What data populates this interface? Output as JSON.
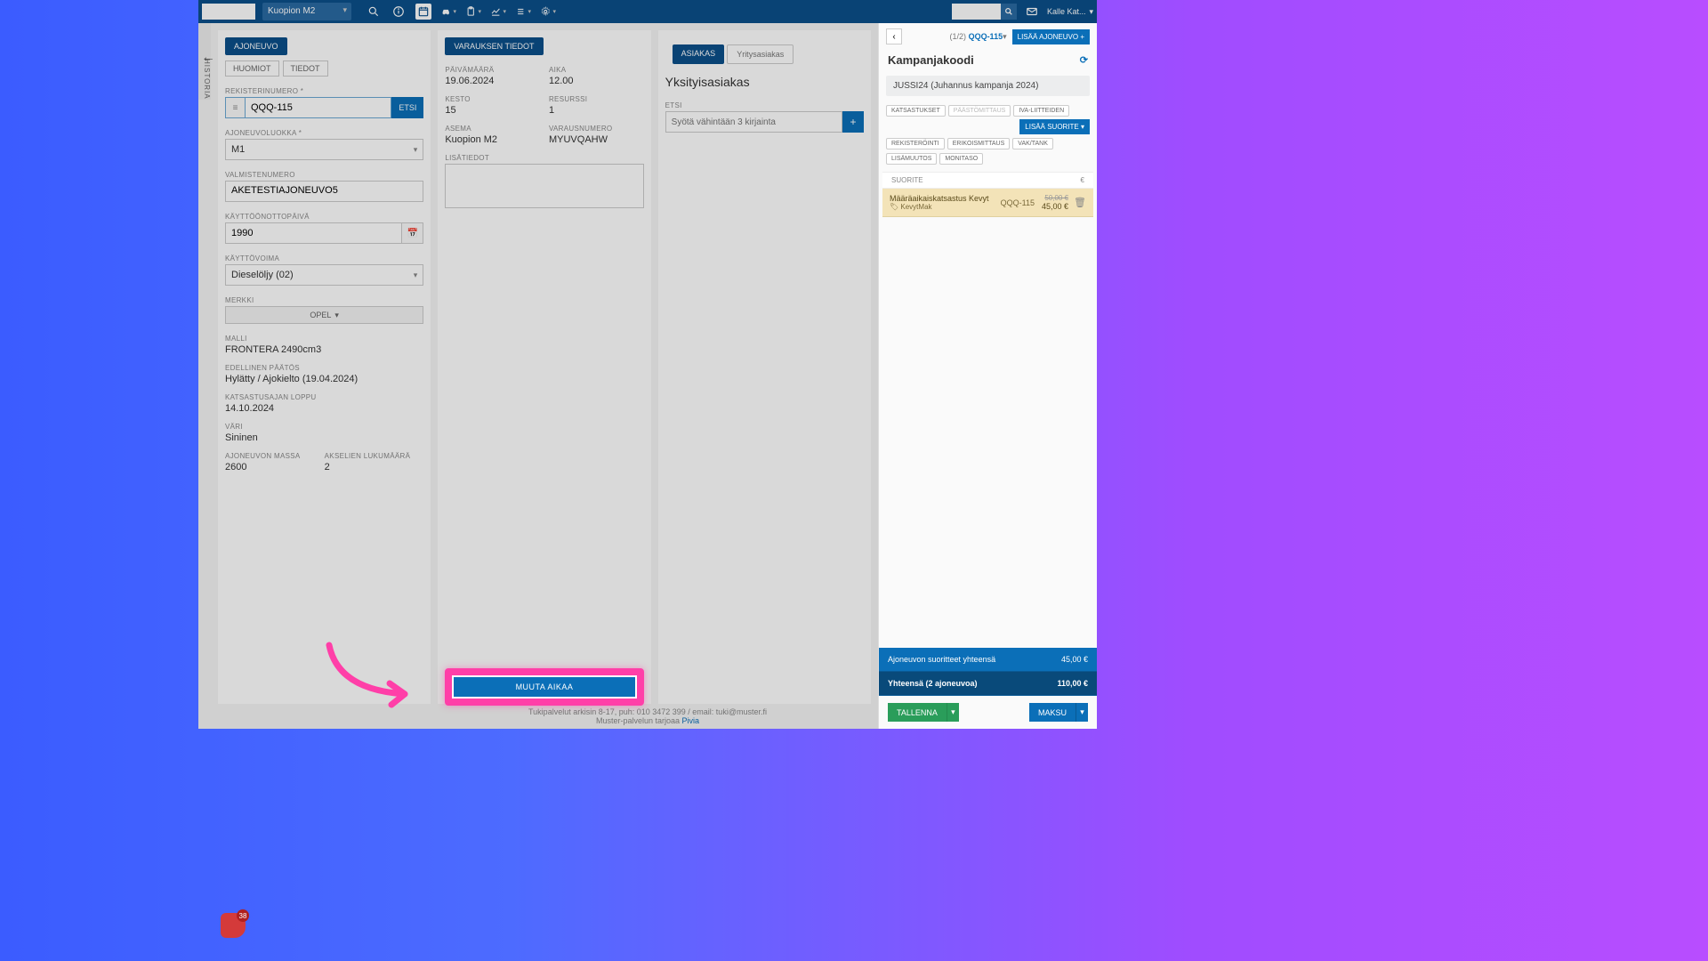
{
  "header": {
    "location": "Kuopion M2",
    "user": "Kalle Kat..."
  },
  "history_tab": "HISTORIA",
  "col1": {
    "tab": "AJONEUVO",
    "subtabs": {
      "huomiot": "HUOMIOT",
      "tiedot": "TIEDOT"
    },
    "labels": {
      "rek": "REKISTERINUMERO *",
      "luokka": "AJONEUVOLUOKKA *",
      "valm": "VALMISTENUMERO",
      "kayttopv": "KÄYTTÖÖNOTTOPÄIVÄ",
      "voima": "KÄYTTÖVOIMA",
      "merkki": "MERKKI",
      "malli": "MALLI",
      "paatos": "EDELLINEN PÄÄTÖS",
      "katsloppu": "KATSASTUSAJAN LOPPU",
      "vari": "VÄRI",
      "massa": "AJONEUVON MASSA",
      "akselit": "AKSELIEN LUKUMÄÄRÄ"
    },
    "values": {
      "rek": "QQQ-115",
      "etsi": "ETSI",
      "luokka": "M1",
      "valm": "AKETESTIAJONEUVO5",
      "kayttopv": "1990",
      "voima": "Dieselöljy (02)",
      "merkki": "OPEL",
      "malli": "FRONTERA 2490cm3",
      "paatos": "Hylätty / Ajokielto (19.04.2024)",
      "katsloppu": "14.10.2024",
      "vari": "Sininen",
      "massa": "2600",
      "akselit": "2"
    }
  },
  "col2": {
    "tab": "VARAUKSEN TIEDOT",
    "labels": {
      "pvm": "PÄIVÄMÄÄRÄ",
      "aika": "AIKA",
      "kesto": "KESTO",
      "resurssi": "RESURSSI",
      "asema": "ASEMA",
      "varausnro": "VARAUSNUMERO",
      "lisat": "LISÄTIEDOT"
    },
    "values": {
      "pvm": "19.06.2024",
      "aika": "12.00",
      "kesto": "15",
      "resurssi": "1",
      "asema": "Kuopion M2",
      "varausnro": "MYUVQAHW"
    },
    "muuta": "MUUTA AIKAA"
  },
  "col3": {
    "tabs": {
      "asiakas": "ASIAKAS",
      "yritys": "Yritysasiakas"
    },
    "cust_type": "Yksityisasiakas",
    "etsi_label": "ETSI",
    "etsi_placeholder": "Syötä vähintään 3 kirjainta"
  },
  "right": {
    "counter_a": "(1/2)",
    "counter_b": "QQQ-115",
    "add_vehicle": "LISÄÄ AJONEUVO +",
    "title": "Kampanjakoodi",
    "campaign": "JUSSI24 (Juhannus kampanja 2024)",
    "chips": [
      "KATSASTUKSET",
      "PÄÄSTÖMITTAUS",
      "IVA-LIITTEIDEN",
      "REKISTERÖINTI",
      "ERIKOISMITTAUS",
      "LISÄMUUTOS",
      "VAK/TANK",
      "MONITASO"
    ],
    "add_suorite": "LISÄÄ SUORITE ▾",
    "hdr": {
      "suorite": "SUORITE",
      "eur": "€"
    },
    "item": {
      "name": "Määräaikaiskatsastus Kevyt",
      "sub": "KevytMak",
      "reg": "QQQ-115",
      "old_price": "50,00 €",
      "price": "45,00 €"
    },
    "sum1_label": "Ajoneuvon suoritteet yhteensä",
    "sum1_val": "45,00 €",
    "sum2_label": "Yhteensä (2 ajoneuvoa)",
    "sum2_val": "110,00 €",
    "save": "TALLENNA",
    "pay": "MAKSU"
  },
  "footer": {
    "line1a": "Tukipalvelut arkisin 8-17, puh: 010 3472 399 / email: tuki@muster.fi",
    "line2a": "Muster-palvelun tarjoaa ",
    "line2b": "Pivia"
  },
  "widget_count": "38"
}
